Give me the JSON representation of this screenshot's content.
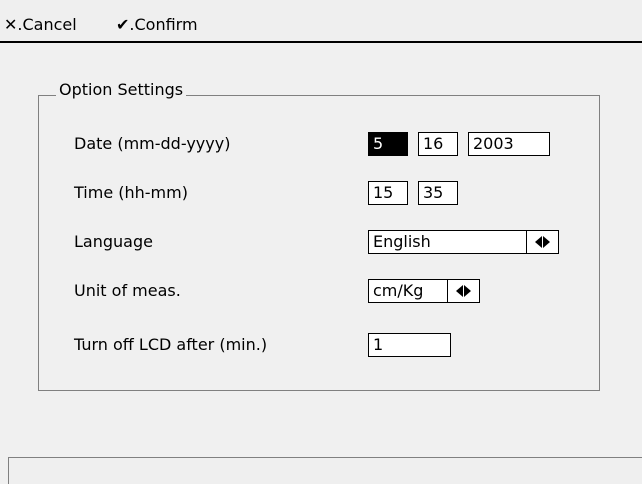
{
  "menu": {
    "cancel_glyph": "✕",
    "cancel_label": ".Cancel",
    "confirm_glyph": "✔",
    "confirm_label": ".Confirm"
  },
  "group": {
    "title": "Option Settings"
  },
  "settings": {
    "date_label": "Date (mm-dd-yyyy)",
    "date_month": "5",
    "date_day": "16",
    "date_year": "2003",
    "time_label": "Time (hh-mm)",
    "time_hour": "15",
    "time_minute": "35",
    "language_label": "Language",
    "language_value": "English",
    "unit_label": "Unit of meas.",
    "unit_value": "cm/Kg",
    "lcd_label": "Turn off LCD after (min.)",
    "lcd_value": "1"
  },
  "status": {
    "text": ""
  },
  "colors": {
    "background": "#f0f0f0",
    "selected_field": "#000000",
    "border": "#000000"
  }
}
